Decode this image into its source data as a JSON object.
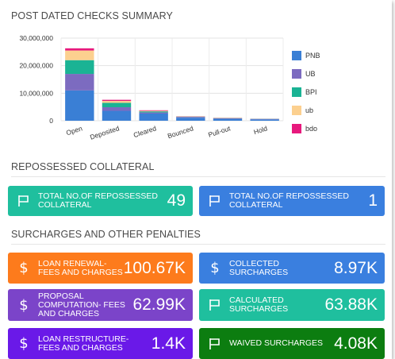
{
  "checks_summary": {
    "title": "POST DATED CHECKS SUMMARY"
  },
  "chart_data": {
    "type": "bar",
    "stacked": true,
    "categories": [
      "Open",
      "Deposited",
      "Cleared",
      "Bounced",
      "Pull-out",
      "Hold"
    ],
    "ylim": [
      0,
      30000000
    ],
    "yticks": [
      "0",
      "10,000,000",
      "20,000,000",
      "30,000,000"
    ],
    "ytick_values": [
      0,
      10000000,
      20000000,
      30000000
    ],
    "grid": true,
    "legend_position": "right",
    "series": [
      {
        "name": "PNB",
        "color": "#3a7fd5",
        "values": [
          11000000,
          3600000,
          2600000,
          1100000,
          700000,
          500000
        ]
      },
      {
        "name": "UB",
        "color": "#7c6bc0",
        "values": [
          6000000,
          1300000,
          400000,
          300000,
          150000,
          150000
        ]
      },
      {
        "name": "BPI",
        "color": "#1ab394",
        "values": [
          5000000,
          1600000,
          400000,
          100000,
          100000,
          50000
        ]
      },
      {
        "name": "ub",
        "color": "#fcd08f",
        "values": [
          3500000,
          700000,
          200000,
          100000,
          100000,
          30000
        ]
      },
      {
        "name": "bdo",
        "color": "#e7197d",
        "values": [
          800000,
          400000,
          200000,
          50000,
          50000,
          20000
        ]
      }
    ]
  },
  "repossessed": {
    "title": "REPOSSESSED COLLATERAL",
    "tiles": [
      {
        "label": "TOTAL NO.OF REPOSSESSED COLLATERAL",
        "value": "49",
        "color": "#1fbf9e"
      },
      {
        "label": "TOTAL NO.OF REPOSSESSED COLLATERAL",
        "value": "1",
        "color": "#3a7fdf"
      }
    ]
  },
  "surcharges": {
    "title": "SURCHARGES AND OTHER PENALTIES",
    "tiles": [
      {
        "label": "LOAN RENEWAL- FEES AND CHARGES",
        "value": "100.67K",
        "color": "#fd7b1c",
        "icon": "dollar-icon"
      },
      {
        "label": "COLLECTED SURCHARGES",
        "value": "8.97K",
        "color": "#3a7fdf",
        "icon": "dollar-icon"
      },
      {
        "label": "PROPOSAL COMPUTATION- FEES AND CHARGES",
        "value": "62.99K",
        "color": "#7b44c9",
        "icon": "dollar-icon"
      },
      {
        "label": "CALCULATED SURCHARGES",
        "value": "63.88K",
        "color": "#1fbf9e",
        "icon": "flag-icon"
      },
      {
        "label": "LOAN RESTRUCTURE- FEES AND CHARGES",
        "value": "1.4K",
        "color": "#6a19e8",
        "icon": "dollar-icon"
      },
      {
        "label": "WAIVED SURCHARGES",
        "value": "4.08K",
        "color": "#0c7d10",
        "icon": "flag-icon"
      }
    ]
  }
}
